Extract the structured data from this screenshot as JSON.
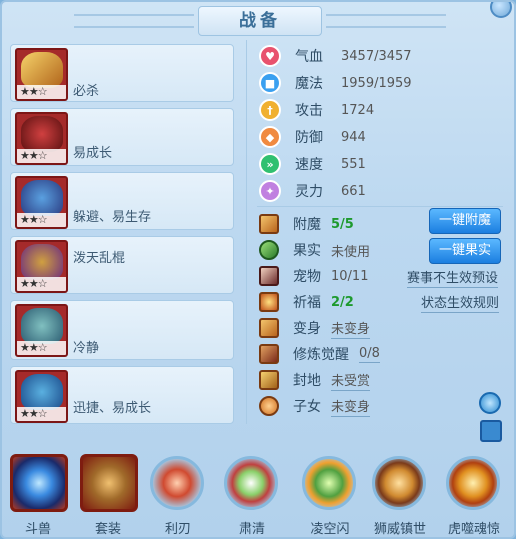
{
  "window": {
    "title": "战备"
  },
  "pets": [
    {
      "label": "必杀",
      "stars": "★★☆",
      "art_color": "#e0a030"
    },
    {
      "label": "易成长",
      "stars": "★★☆",
      "art_color": "#7a1d1d"
    },
    {
      "label": "躲避、易生存",
      "stars": "★★☆",
      "art_color": "#3a6da8"
    },
    {
      "label": "泼天乱棍",
      "stars": "★★☆",
      "art_color": "#8a3aa0"
    },
    {
      "label": "冷静",
      "stars": "★★☆",
      "art_color": "#4a8a9a"
    },
    {
      "label": "迅捷、易成长",
      "stars": "★★☆",
      "art_color": "#2f6aa0"
    }
  ],
  "attributes": [
    {
      "name": "气血",
      "value": "3457/3457",
      "icon": "heart-icon",
      "color": "#e8526e"
    },
    {
      "name": "魔法",
      "value": "1959/1959",
      "icon": "mana-icon",
      "color": "#3aa0f0"
    },
    {
      "name": "攻击",
      "value": "1724",
      "icon": "sword-icon",
      "color": "#f0b030"
    },
    {
      "name": "防御",
      "value": "944",
      "icon": "shield-icon",
      "color": "#f08a40"
    },
    {
      "name": "速度",
      "value": "551",
      "icon": "speed-icon",
      "color": "#30c070"
    },
    {
      "name": "灵力",
      "value": "661",
      "icon": "spirit-icon",
      "color": "#c080e0"
    }
  ],
  "equipment": [
    {
      "name": "附魔",
      "value": "5/5",
      "style": "green"
    },
    {
      "name": "果实",
      "value": "未使用",
      "style": ""
    },
    {
      "name": "宠物",
      "value": "10/11",
      "style": ""
    },
    {
      "name": "祈福",
      "value": "2/2",
      "style": "green"
    },
    {
      "name": "变身",
      "value": "未变身",
      "style": "ul"
    },
    {
      "name": "修炼觉醒",
      "value": "0/8",
      "style": "ul"
    },
    {
      "name": "封地",
      "value": "未受赏",
      "style": "ul"
    },
    {
      "name": "子女",
      "value": "未变身",
      "style": "ul"
    }
  ],
  "buttons": {
    "enchant": "一键附魔",
    "fruit": "一键果实",
    "preset": "赛事不生效预设",
    "rules": "状态生效规则"
  },
  "bottom": [
    {
      "label": "斗兽",
      "kind": "square",
      "art": "#3aa0ff"
    },
    {
      "label": "套装",
      "kind": "square",
      "art": "#c08a3a"
    },
    {
      "label": "利刃",
      "kind": "circle",
      "art": "#d04a30"
    },
    {
      "label": "肃清",
      "kind": "circle",
      "art": "#6ab84a"
    },
    {
      "label": "凌空闪",
      "kind": "circle",
      "art": "#50a040"
    },
    {
      "label": "狮威镇世",
      "kind": "circle",
      "art": "#d08a30"
    },
    {
      "label": "虎噬魂惊",
      "kind": "circle",
      "art": "#e09020"
    }
  ]
}
